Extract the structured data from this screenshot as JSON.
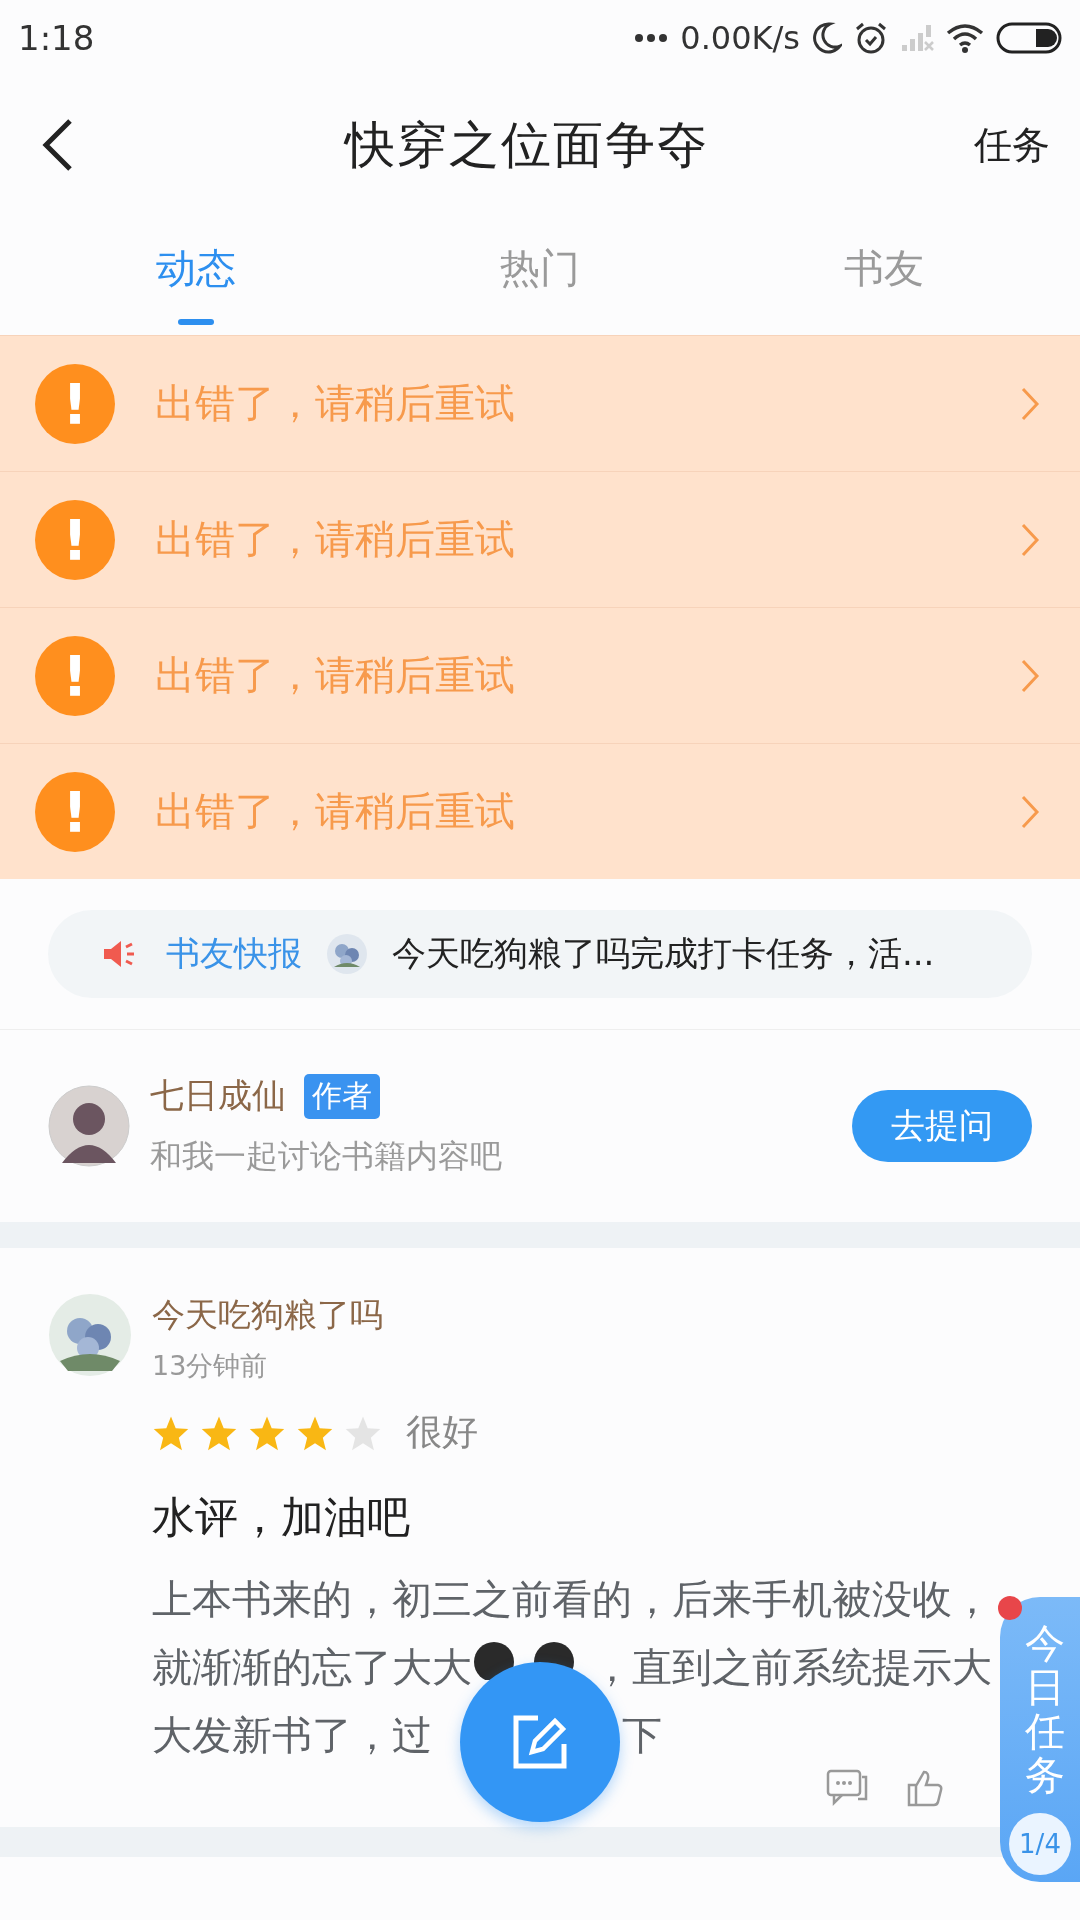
{
  "status_bar": {
    "time": "1:18",
    "network_speed": "0.00K/s"
  },
  "nav": {
    "title": "快穿之位面争夺",
    "action": "任务"
  },
  "tabs": [
    {
      "label": "动态",
      "selected": true
    },
    {
      "label": "热门",
      "selected": false
    },
    {
      "label": "书友",
      "selected": false
    }
  ],
  "errors": [
    {
      "icon": "!",
      "message": "出错了，请稍后重试"
    },
    {
      "icon": "!",
      "message": "出错了，请稍后重试"
    },
    {
      "icon": "!",
      "message": "出错了，请稍后重试"
    },
    {
      "icon": "!",
      "message": "出错了，请稍后重试"
    }
  ],
  "ticker": {
    "label": "书友快报",
    "text": "今天吃狗粮了吗完成打卡任务，活..."
  },
  "author": {
    "name": "七日成仙",
    "tag": "作者",
    "subtitle": "和我一起讨论书籍内容吧",
    "button": "去提问"
  },
  "review": {
    "user": "今天吃狗粮了吗",
    "time": "13分钟前",
    "stars": 4,
    "rating_label": "很好",
    "title": "水评，加油吧",
    "lines": [
      [
        {
          "kind": "text",
          "text": "上本书来的，初三之前看的，后来手机被没收，"
        }
      ],
      [
        {
          "kind": "text",
          "text": "就渐渐的忘了大大"
        },
        {
          "kind": "emoji"
        },
        {
          "kind": "text",
          "text": "，直到之前系统提示大"
        }
      ],
      [
        {
          "kind": "text",
          "text": "大发新书了，过"
        },
        {
          "kind": "covered"
        },
        {
          "kind": "text",
          "text": "下"
        }
      ]
    ]
  },
  "daily_task": {
    "label": "今日任务",
    "progress": "1/4"
  }
}
